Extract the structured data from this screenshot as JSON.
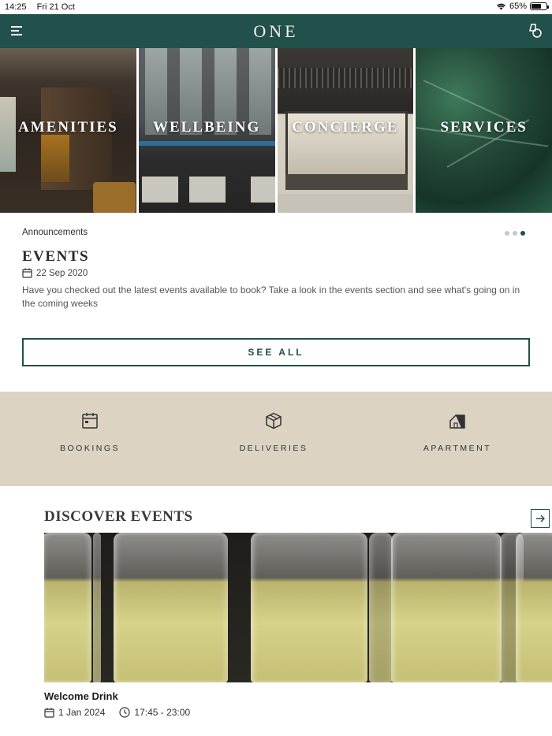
{
  "status_bar": {
    "time": "14:25",
    "date": "Fri 21 Oct",
    "battery_percent_text": "65%",
    "battery_level": 0.65
  },
  "header": {
    "title": "ONE",
    "menu_icon": "menu-icon",
    "right_icon": "shapes-icon",
    "brand_color": "#22504a"
  },
  "tiles": [
    {
      "label": "AMENITIES"
    },
    {
      "label": "WELLBEING"
    },
    {
      "label": "CONCIERGE"
    },
    {
      "label": "SERVICES"
    }
  ],
  "announcements": {
    "section_label": "Announcements",
    "title": "EVENTS",
    "date": "22 Sep 2020",
    "body": "Have you checked out the latest events available to book? Take a look in the events section and see what's going on in the coming weeks",
    "see_all_label": "SEE ALL",
    "pager": {
      "count": 3,
      "active_index": 2
    }
  },
  "quick_actions": [
    {
      "label": "BOOKINGS",
      "icon": "calendar-icon"
    },
    {
      "label": "DELIVERIES",
      "icon": "package-icon"
    },
    {
      "label": "APARTMENT",
      "icon": "house-icon"
    }
  ],
  "discover": {
    "title": "DISCOVER EVENTS",
    "next_icon": "arrow-right-icon",
    "event": {
      "name": "Welcome Drink",
      "date": "1 Jan 2024",
      "time": "17:45 - 23:00",
      "image": "champagne-glasses"
    }
  },
  "colors": {
    "accent": "#22504a",
    "band": "#dcd3c3"
  }
}
